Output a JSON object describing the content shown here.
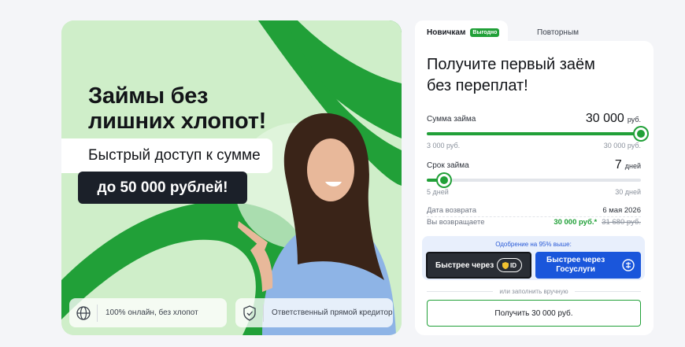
{
  "banner": {
    "headline_line1": "Займы без",
    "headline_line2": "лишних хлопот!",
    "subtitle": "Быстрый доступ к сумме",
    "highlight": "до 50 000 рублей!",
    "features": [
      {
        "icon": "globe-icon",
        "text": "100% онлайн, без хлопот"
      },
      {
        "icon": "shield-check-icon",
        "text": "Ответственный прямой кредитор"
      }
    ],
    "colors": {
      "accent_green": "#21a038",
      "light_green": "#cfeec9"
    }
  },
  "tabs": [
    {
      "label": "Новичкам",
      "badge": "Выгодно",
      "active": true
    },
    {
      "label": "Повторным",
      "active": false
    }
  ],
  "form": {
    "title_line1": "Получите первый заём",
    "title_line2": "без переплат!",
    "amount": {
      "label": "Сумма займа",
      "value": "30 000",
      "unit": "руб.",
      "min": "3 000 руб.",
      "max": "30 000 руб.",
      "fraction": 1.0
    },
    "term": {
      "label": "Срок займа",
      "value": "7",
      "unit": "дней",
      "min": "5 дней",
      "max": "30 дней",
      "fraction": 0.08
    },
    "return_date": {
      "label": "Дата возврата",
      "value": "6 мая 2026"
    },
    "repay": {
      "label": "Вы возвращаете",
      "value": "30 000 руб.*",
      "old_value": "31 680 руб."
    },
    "gosuslugi": {
      "caption": "Одобрение на 95% выше:",
      "id_button": "Быстрее через",
      "id_badge": "ID",
      "gos_button_line1": "Быстрее через",
      "gos_button_line2": "Госуслуги"
    },
    "or_text": "или заполнить вручную",
    "submit_label": "Получить 30 000 руб."
  }
}
